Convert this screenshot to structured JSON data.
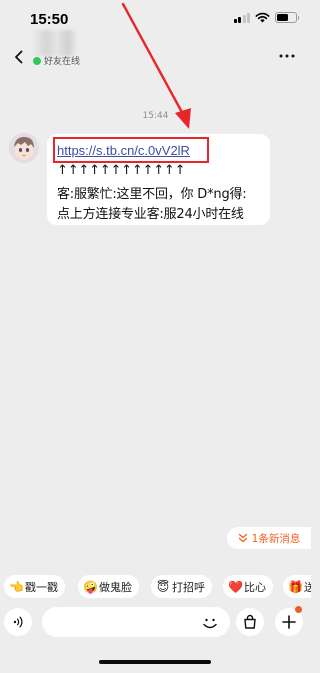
{
  "status_bar": {
    "time": "15:50"
  },
  "header": {
    "online_status": "好友在线"
  },
  "chat": {
    "timestamp": "15:44",
    "message": {
      "link": "https://s.tb.cn/c.0vV2lR",
      "lines": [
        "↑↑↑↑↑↑↑↑↑↑↑↑",
        "客:服繁忙:这里不回，你 D*ng得:",
        "点上方连接专业客:服24小时在线"
      ]
    },
    "new_messages": "1条新消息"
  },
  "quick_replies": [
    {
      "emoji": "👈",
      "label": "戳一戳"
    },
    {
      "emoji": "🤪",
      "label": "做鬼脸"
    },
    {
      "emoji": "😇",
      "label": "打招呼"
    },
    {
      "emoji": "❤️",
      "label": "比心"
    },
    {
      "emoji": "🎁",
      "label": "送"
    }
  ],
  "input": {
    "placeholder": ""
  },
  "colors": {
    "highlight_box": "#e8262a",
    "link": "#3a4fa8",
    "accent": "#f06020",
    "online": "#34c759"
  }
}
